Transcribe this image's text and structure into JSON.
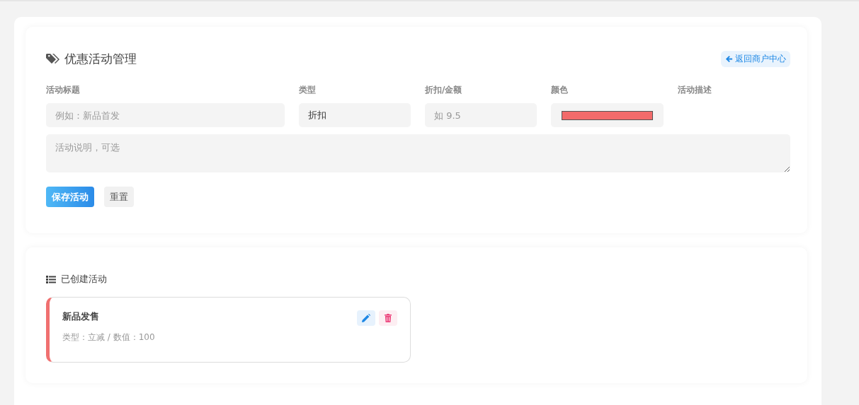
{
  "header": {
    "title": "优惠活动管理",
    "back_link": "返回商户中心"
  },
  "fields": [
    {
      "kind": "text",
      "label": "活动标题",
      "placeholder": "例如：新品首发"
    },
    {
      "kind": "select",
      "label": "类型",
      "value": "折扣"
    },
    {
      "kind": "text",
      "label": "折扣/金额",
      "placeholder": "如 9.5"
    },
    {
      "kind": "color",
      "label": "颜色",
      "color": "#f26b6b"
    },
    {
      "kind": "textarea",
      "label": "活动描述",
      "placeholder": "活动说明，可选"
    }
  ],
  "buttons": [
    {
      "kind": "primary",
      "label": "保存活动"
    },
    {
      "kind": "plain",
      "label": "重置"
    }
  ],
  "list": {
    "title": "已创建活动",
    "activities": [
      {
        "title": "新品发售",
        "meta": "类型：立减 / 数值：100",
        "color": "#f07070"
      }
    ]
  }
}
